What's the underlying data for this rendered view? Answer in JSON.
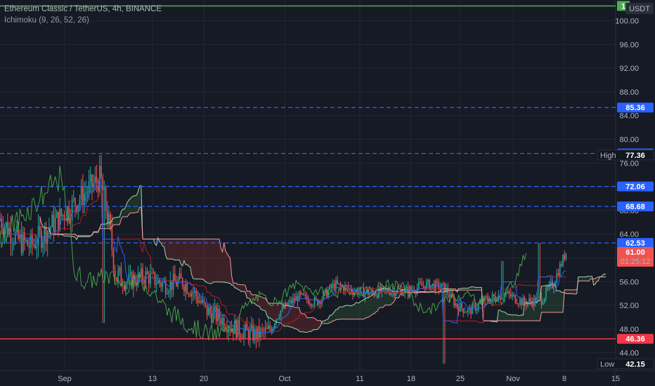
{
  "header": {
    "title": "Ethereum Classic / TetherUS, 4h, BINANCE",
    "indicator": "Ichimoku (9, 26, 52, 26)",
    "currency": "USDT"
  },
  "colors": {
    "background": "#161a25",
    "grid": "#232733",
    "up": "#26a69a",
    "down": "#ef5350",
    "tenkan": "#2962ff",
    "kijun": "#b71c1c",
    "chikou": "#43a047",
    "spanA": "#a5d6a7",
    "spanB": "#ef9a9a",
    "cloud_up": "rgba(67,160,71,0.18)",
    "cloud_down": "rgba(244,67,54,0.18)",
    "level": "#2962ff",
    "support": "#f23645",
    "resistance": "#4caf50"
  },
  "chart_data": {
    "type": "candlestick",
    "title": "Ethereum Classic / TetherUS, 4h, BINANCE",
    "indicator": "Ichimoku (9, 26, 52, 26)",
    "ylim": [
      41.0,
      103.5
    ],
    "y_ticks": [
      44,
      48,
      52,
      56,
      60,
      64,
      68,
      72,
      76,
      80,
      84,
      88,
      92,
      96,
      100
    ],
    "x_ticks": [
      "Sep",
      "13",
      "20",
      "Oct",
      "11",
      "18",
      "25",
      "Nov",
      "8",
      "15"
    ],
    "price_levels": [
      85.36,
      77.62,
      72.06,
      68.68,
      62.53
    ],
    "high": {
      "label": "High",
      "value": 77.36
    },
    "low": {
      "label": "Low",
      "value": 42.15
    },
    "support": {
      "value": 46.36
    },
    "resistance": {
      "value": 102.5
    },
    "current_price": {
      "value": 61.0,
      "countdown": "01:25:12"
    },
    "price_path": [
      {
        "t": 0,
        "p": 66.5
      },
      {
        "t": 0.03,
        "p": 63
      },
      {
        "t": 0.05,
        "p": 62
      },
      {
        "t": 0.08,
        "p": 65
      },
      {
        "t": 0.11,
        "p": 68
      },
      {
        "t": 0.14,
        "p": 71
      },
      {
        "t": 0.165,
        "p": 73.5
      },
      {
        "t": 0.18,
        "p": 65
      },
      {
        "t": 0.19,
        "p": 57
      },
      {
        "t": 0.21,
        "p": 56
      },
      {
        "t": 0.24,
        "p": 57
      },
      {
        "t": 0.27,
        "p": 55.5
      },
      {
        "t": 0.3,
        "p": 56
      },
      {
        "t": 0.32,
        "p": 54
      },
      {
        "t": 0.34,
        "p": 51
      },
      {
        "t": 0.36,
        "p": 50
      },
      {
        "t": 0.38,
        "p": 48.5
      },
      {
        "t": 0.4,
        "p": 47.5
      },
      {
        "t": 0.42,
        "p": 47
      },
      {
        "t": 0.44,
        "p": 47.5
      },
      {
        "t": 0.46,
        "p": 51
      },
      {
        "t": 0.49,
        "p": 53.5
      },
      {
        "t": 0.52,
        "p": 52.5
      },
      {
        "t": 0.55,
        "p": 55.5
      },
      {
        "t": 0.58,
        "p": 54.5
      },
      {
        "t": 0.61,
        "p": 54
      },
      {
        "t": 0.64,
        "p": 54.5
      },
      {
        "t": 0.67,
        "p": 54.5
      },
      {
        "t": 0.7,
        "p": 55.5
      },
      {
        "t": 0.73,
        "p": 55
      },
      {
        "t": 0.75,
        "p": 52
      },
      {
        "t": 0.77,
        "p": 51
      },
      {
        "t": 0.8,
        "p": 53
      },
      {
        "t": 0.83,
        "p": 54
      },
      {
        "t": 0.86,
        "p": 52.5
      },
      {
        "t": 0.89,
        "p": 53
      },
      {
        "t": 0.91,
        "p": 56
      },
      {
        "t": 0.93,
        "p": 61
      }
    ],
    "wick_events": [
      {
        "t": 0.165,
        "high": 77.36
      },
      {
        "t": 0.17,
        "low": 49
      },
      {
        "t": 0.73,
        "low": 42.15
      },
      {
        "t": 0.825,
        "high": 59.5
      },
      {
        "t": 0.885,
        "high": 62.5
      }
    ]
  }
}
